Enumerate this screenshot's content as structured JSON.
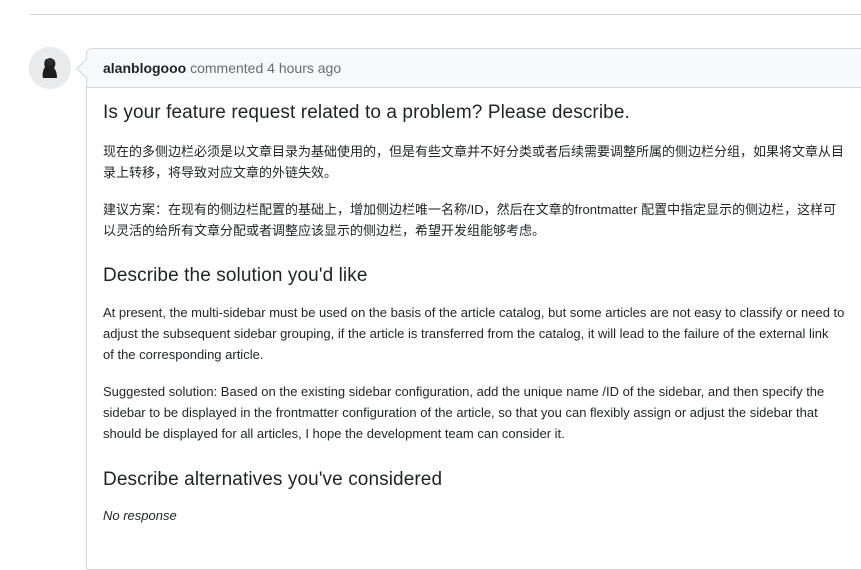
{
  "comment": {
    "author": "alanblogooo",
    "action": "commented",
    "time": "4 hours ago"
  },
  "sections": [
    {
      "heading": "Is your feature request related to a problem? Please describe.",
      "paragraphs": [
        [
          "现在的多侧边栏必须是以文章目录为基础使用的，但是有些文章并不好分类或者后续需要调整所属的侧边栏分组，如果将文章从目",
          "录上转移，将导致对应文章的外链失效。"
        ],
        [
          "建议方案：在现有的侧边栏配置的基础上，增加侧边栏唯一名称/ID，然后在文章的frontmatter 配置中指定显示的侧边栏，这样可",
          "以灵活的给所有文章分配或者调整应该显示的侧边栏，希望开发组能够考虑。"
        ]
      ]
    },
    {
      "heading": "Describe the solution you'd like",
      "paragraphs": [
        [
          "At present, the multi-sidebar must be used on the basis of the article catalog, but some articles are not easy to classify or need to",
          "adjust the subsequent sidebar grouping, if the article is transferred from the catalog, it will lead to the failure of the external link",
          "of the corresponding article."
        ],
        [
          "Suggested solution: Based on the existing sidebar configuration, add the unique name /ID of the sidebar, and then specify the",
          "sidebar to be displayed in the frontmatter configuration of the article, so that you can flexibly assign or adjust the sidebar that",
          "should be displayed for all articles, I hope the development team can consider it."
        ]
      ]
    },
    {
      "heading": "Describe alternatives you've considered",
      "note": "No response"
    }
  ]
}
